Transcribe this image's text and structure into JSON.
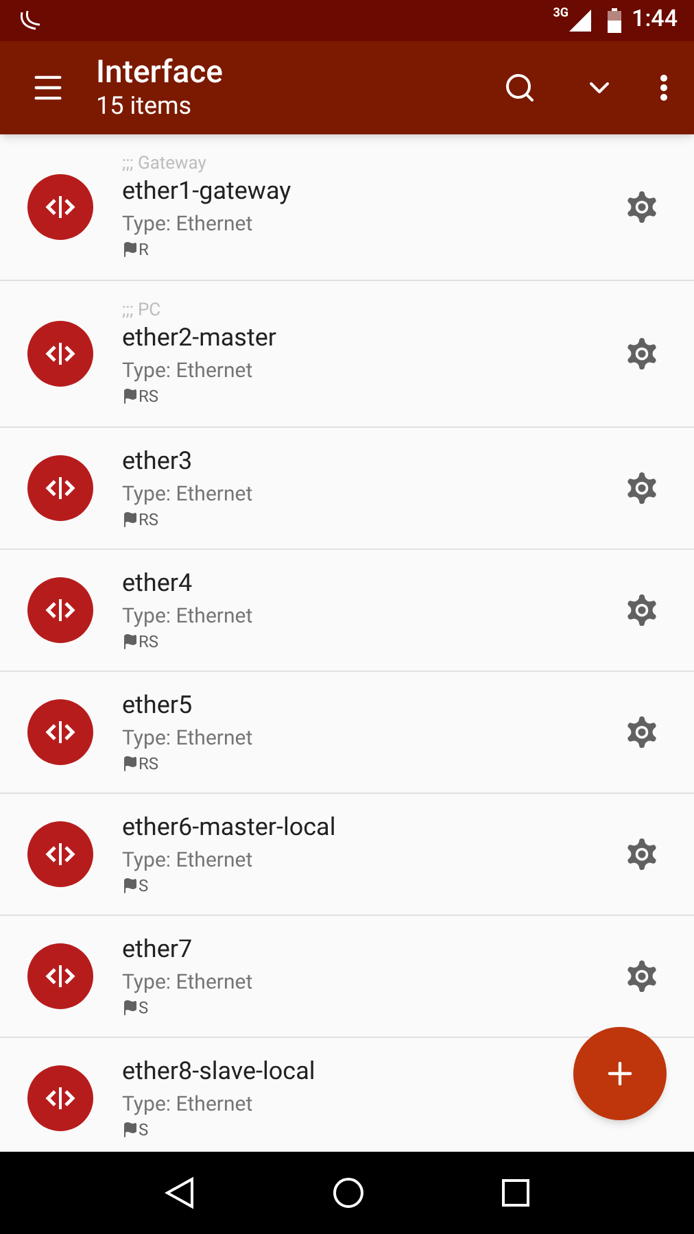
{
  "status_bar": {
    "network": "3G",
    "time": "1:44"
  },
  "toolbar": {
    "title": "Interface",
    "subtitle": "15 items"
  },
  "interfaces": [
    {
      "comment": ";;; Gateway",
      "name": "ether1-gateway",
      "type": "Type: Ethernet",
      "flags": "R"
    },
    {
      "comment": ";;; PC",
      "name": "ether2-master",
      "type": "Type: Ethernet",
      "flags": "RS"
    },
    {
      "name": "ether3",
      "type": "Type: Ethernet",
      "flags": "RS"
    },
    {
      "name": "ether4",
      "type": "Type: Ethernet",
      "flags": "RS"
    },
    {
      "name": "ether5",
      "type": "Type: Ethernet",
      "flags": "RS"
    },
    {
      "name": "ether6-master-local",
      "type": "Type: Ethernet",
      "flags": "S"
    },
    {
      "name": "ether7",
      "type": "Type: Ethernet",
      "flags": "S"
    },
    {
      "name": "ether8-slave-local",
      "type": "Type: Ethernet",
      "flags": "S"
    }
  ]
}
